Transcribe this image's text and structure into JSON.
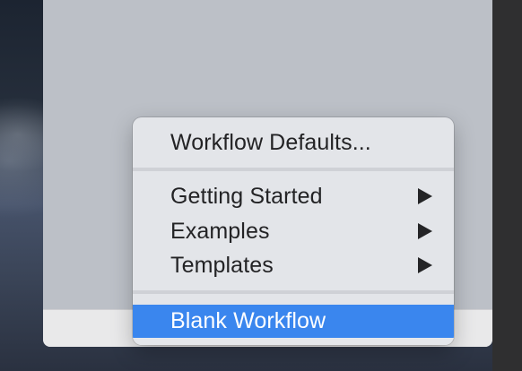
{
  "menu": {
    "items": [
      {
        "label": "Workflow Defaults...",
        "submenu": false,
        "highlighted": false
      },
      {
        "label": "Getting Started",
        "submenu": true,
        "highlighted": false
      },
      {
        "label": "Examples",
        "submenu": true,
        "highlighted": false
      },
      {
        "label": "Templates",
        "submenu": true,
        "highlighted": false
      },
      {
        "label": "Blank Workflow",
        "submenu": false,
        "highlighted": true
      }
    ],
    "highlight_color": "#3a86ee"
  },
  "bottom_bar": {
    "remove_icon": "minus-icon"
  }
}
